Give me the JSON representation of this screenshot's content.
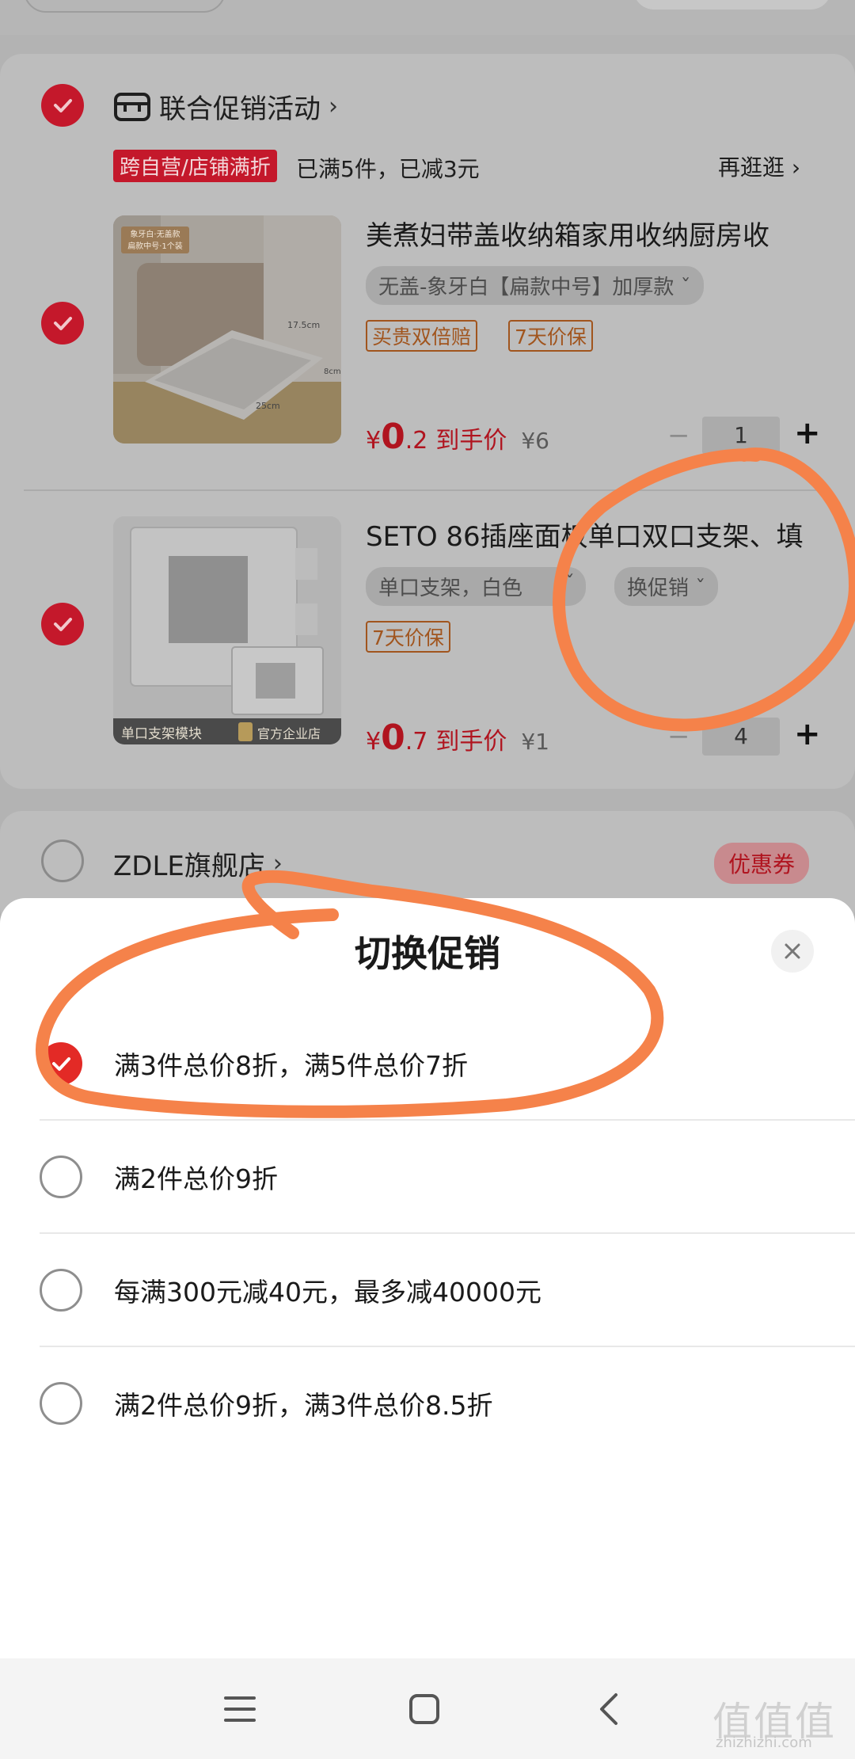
{
  "colors": {
    "brand_red": "#c4182b",
    "sheet_check": "#e32a26",
    "annotation_orange": "#f5824a",
    "badge_brown": "#a1551e"
  },
  "store1": {
    "name": "联合促销活动",
    "chevron": "›",
    "icon": "store-icon",
    "promo_tag": "跨自营/店铺满折",
    "promo_text": "已满5件，已减3元",
    "more_link": "再逛逛 ›"
  },
  "products": [
    {
      "title": "美煮妇带盖收纳箱家用收纳厨房收",
      "spec": "无盖-象牙白【扁款中号】加厚款 ˇ",
      "badges": [
        "买贵双倍赔",
        "7天价保"
      ],
      "price_symbol": "¥",
      "price_int": "0",
      "price_dec": ".2",
      "price_label": "到手价",
      "orig_price": "¥6",
      "qty_minus": "−",
      "qty": "1",
      "qty_plus": "+",
      "thumb_tag1": "象牙白·无盖款",
      "thumb_tag2": "扁款中号·1个装",
      "thumb_dim1": "17.5cm",
      "thumb_dim2": "25cm",
      "thumb_dim3": "8cm"
    },
    {
      "title": "SETO 86插座面板单口双口支架、填",
      "spec": "单口支架，白色",
      "spec_caret": "ˇ",
      "switch_promo": "换促销 ˇ",
      "badges": [
        "7天价保"
      ],
      "price_symbol": "¥",
      "price_int": "0",
      "price_dec": ".7",
      "price_label": "到手价",
      "orig_price": "¥1",
      "qty_minus": "−",
      "qty": "4",
      "qty_plus": "+",
      "thumb_caption": "单口支架模块",
      "thumb_store": "官方企业店"
    }
  ],
  "store2": {
    "name": "ZDLE旗舰店",
    "chevron": "›",
    "coupon": "优惠券"
  },
  "sheet": {
    "title": "切换促销",
    "close_icon": "close-icon",
    "options": [
      {
        "label": "满3件总价8折，满5件总价7折",
        "selected": true
      },
      {
        "label": "满2件总价9折",
        "selected": false
      },
      {
        "label": "每满300元减40元，最多减40000元",
        "selected": false
      },
      {
        "label": "满2件总价9折，满3件总价8.5折",
        "selected": false
      }
    ]
  },
  "navbar": {
    "icons": [
      "menu-icon",
      "home-square-icon",
      "back-icon"
    ]
  },
  "watermark": {
    "text": "值值值",
    "sub": "zhizhizhi.com"
  }
}
